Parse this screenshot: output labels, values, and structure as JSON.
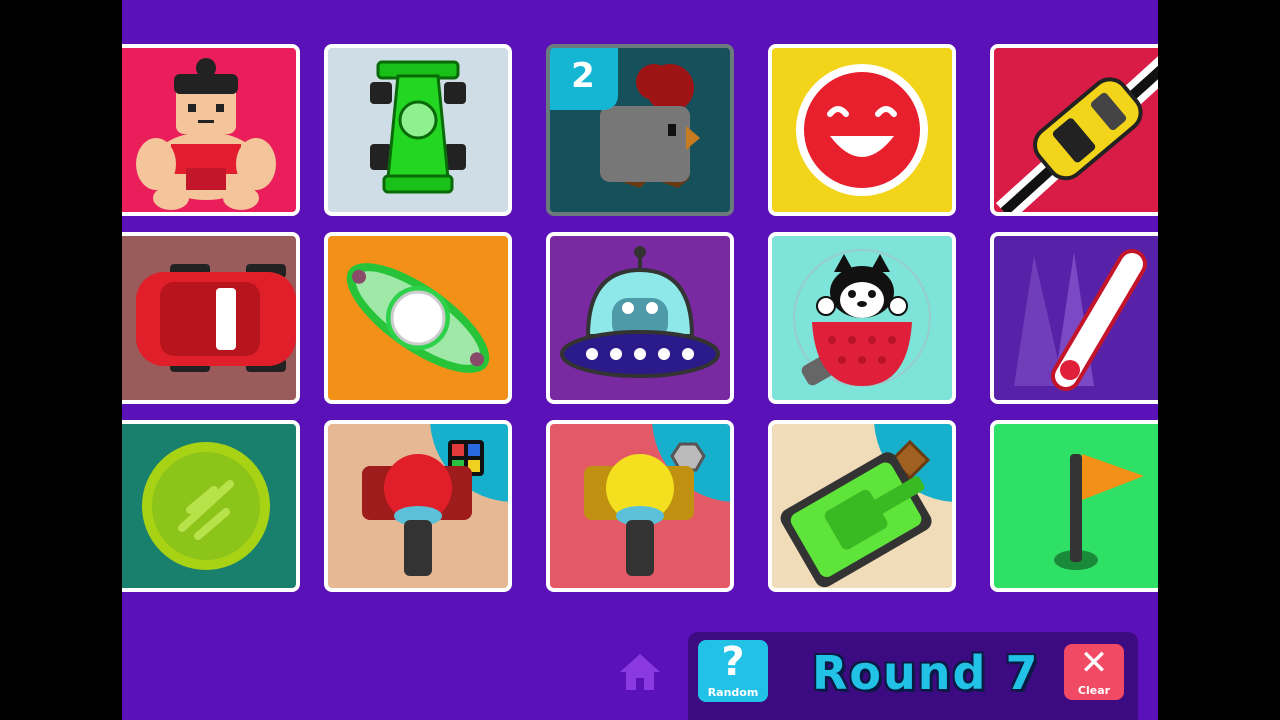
{
  "grid": {
    "badge_count": "2"
  },
  "toolbar": {
    "round_text": "Round 7",
    "random_label": "Random",
    "clear_label": "Clear",
    "random_glyph": "?",
    "clear_glyph": "✕"
  },
  "icons": {
    "home": "home-icon",
    "random": "question-icon",
    "clear": "close-icon"
  },
  "colors": {
    "background": "#5a12b8",
    "accent_cyan": "#21c2e6",
    "clear_red": "#f04a64"
  }
}
